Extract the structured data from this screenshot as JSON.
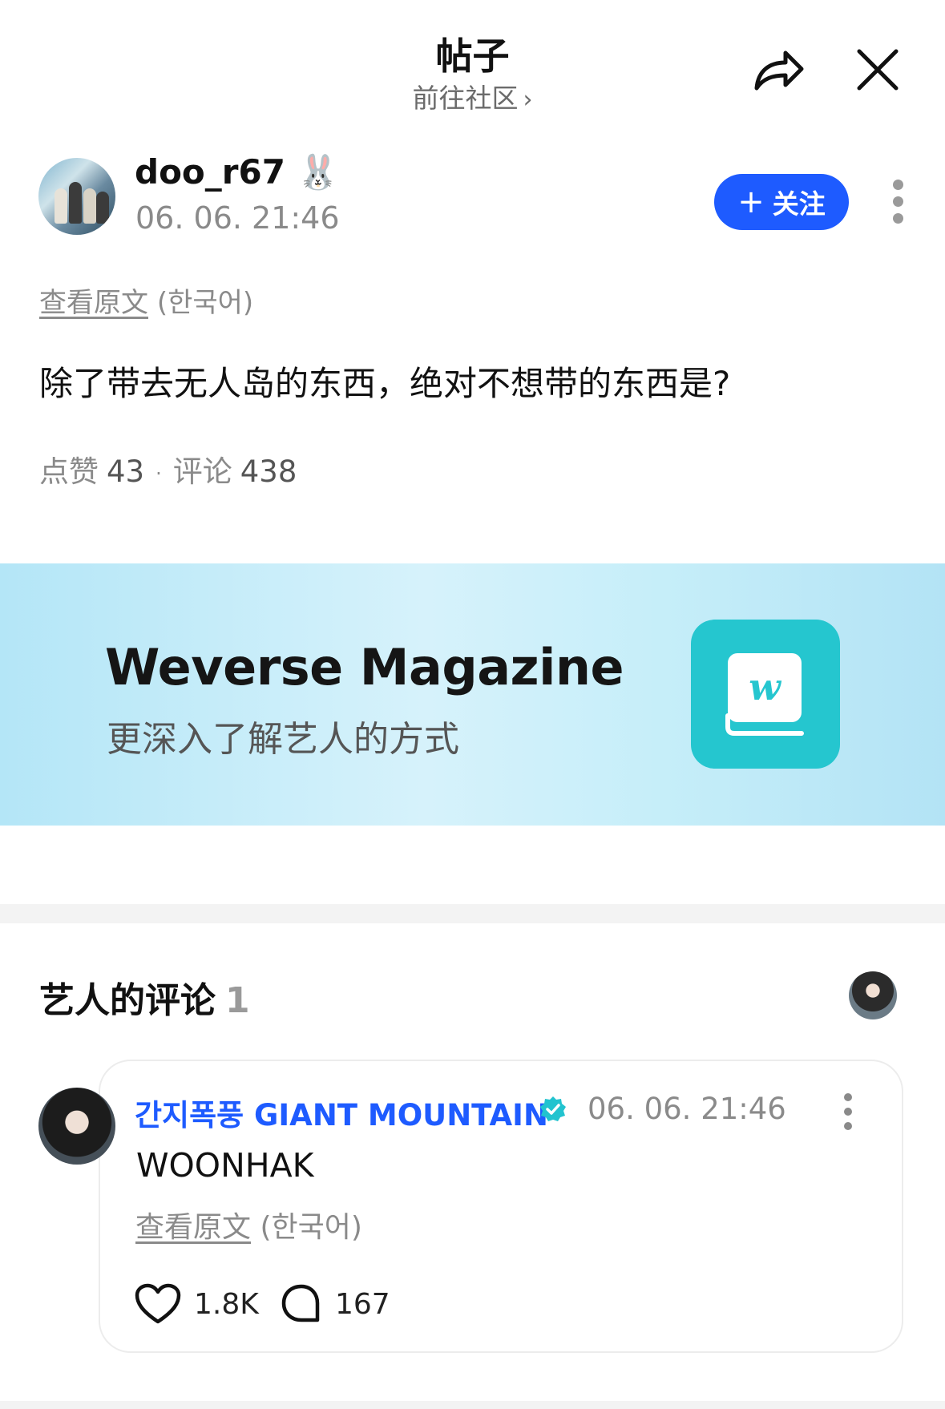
{
  "header": {
    "title": "帖子",
    "subtitle": "前往社区",
    "subtitle_chevron": "›",
    "share_icon": "share-icon",
    "close_icon": "close-icon"
  },
  "post": {
    "author": {
      "name": "doo_r67",
      "emoji": "🐰",
      "time": "06. 06. 21:46"
    },
    "follow_button": {
      "icon": "+",
      "label": "关注"
    },
    "view_original": {
      "label": "查看原文",
      "language": "(한국어)"
    },
    "text": "除了带去无人岛的东西，绝对不想带的东西是?",
    "stats": {
      "likes_label": "点赞",
      "likes": "43",
      "separator": "·",
      "comments_label": "评论",
      "comments": "438"
    }
  },
  "banner": {
    "title": "Weverse Magazine",
    "subtitle": "更深入了解艺人的方式",
    "icon": "weverse-magazine-book-icon"
  },
  "artist_comments": {
    "header_label": "艺人的评论",
    "count": "1",
    "comment": {
      "author": "간지폭풍 GIANT MOUNTAIN",
      "verified_icon": "verified-badge-icon",
      "time": "06. 06. 21:46",
      "text": "WOONHAK",
      "view_original": {
        "label": "查看原文",
        "language": "(한국어)"
      },
      "likes": "1.8K",
      "replies": "167"
    }
  },
  "colors": {
    "accent_blue": "#1e5bff",
    "banner_icon_teal": "#25c6cf",
    "muted_text": "#8a8a8a"
  }
}
